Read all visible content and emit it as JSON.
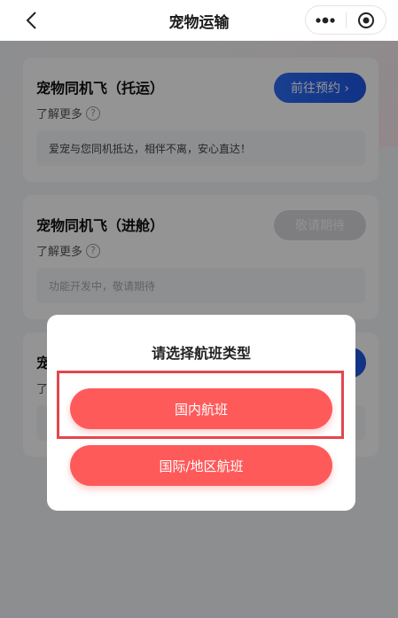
{
  "nav": {
    "title": "宠物运输",
    "back_icon": "chevron-left-icon",
    "more_icon": "more-dots-icon",
    "close_icon": "target-close-icon"
  },
  "cards": [
    {
      "title": "宠物同机飞（托运）",
      "learn_more": "了解更多",
      "button": "前往预约 ›",
      "button_state": "active",
      "desc": "爱宠与您同机抵达，相伴不离，安心直达！"
    },
    {
      "title": "宠物同机飞（进舱）",
      "learn_more": "了解更多",
      "button": "敬请期待",
      "button_state": "disabled",
      "desc": "功能开发中，敬请期待"
    },
    {
      "title": "宠",
      "learn_more": "了"
    }
  ],
  "modal": {
    "title": "请选择航班类型",
    "options": [
      "国内航班",
      "国际/地区航班"
    ],
    "highlighted_option": "国内航班"
  },
  "colors": {
    "accent_red": "#ff5a5a",
    "accent_blue": "#1e57e6",
    "highlight_border": "#e2474d"
  }
}
